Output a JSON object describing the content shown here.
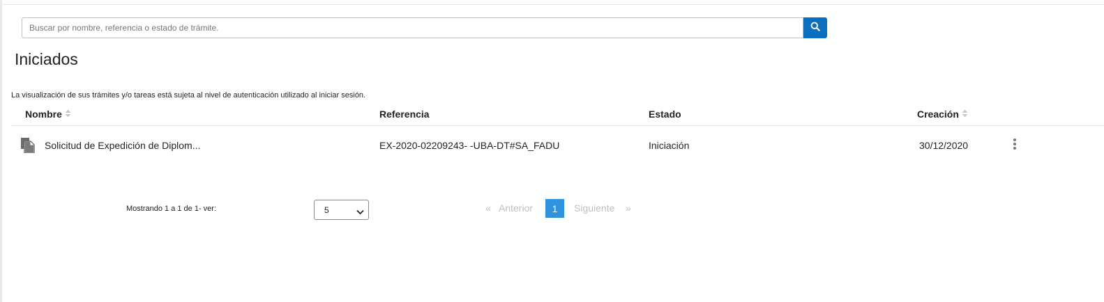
{
  "search": {
    "placeholder": "Buscar por nombre, referencia o estado de trámite.",
    "value": ""
  },
  "page": {
    "title": "Iniciados",
    "notice": "La visualización de sus trámites y/o tareas está sujeta al nivel de autenticación utilizado al iniciar sesión."
  },
  "table": {
    "columns": {
      "nombre": "Nombre",
      "referencia": "Referencia",
      "estado": "Estado",
      "creacion": "Creación"
    },
    "rows": [
      {
        "nombre": "Solicitud de Expedición de Diplom...",
        "referencia": "EX-2020-02209243- -UBA-DT#SA_FADU",
        "estado": "Iniciación",
        "creacion": "30/12/2020",
        "icon": "document-icon"
      }
    ]
  },
  "pagination": {
    "showing": "Mostrando 1 a 1 de 1- ver:",
    "per_page": "5",
    "prev_arrow": "«",
    "prev": "Anterior",
    "current": "1",
    "next": "Siguiente",
    "next_arrow": "»"
  },
  "colors": {
    "accent": "#0b6fbd",
    "current_page": "#2f93e0",
    "disabled": "#c0c0c0"
  }
}
